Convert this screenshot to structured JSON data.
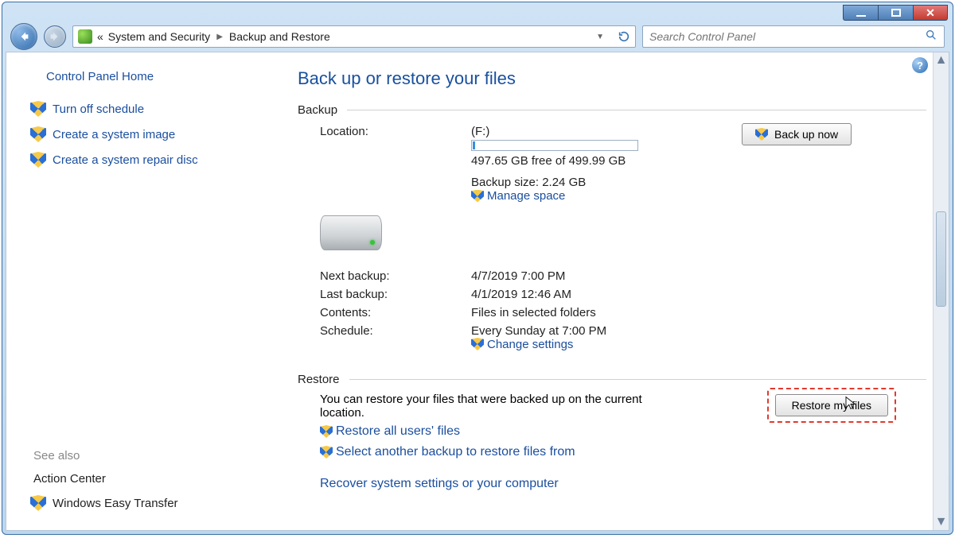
{
  "titlebar": {},
  "address": {
    "chevrons": "«",
    "crumb1": "System and Security",
    "crumb2": "Backup and Restore"
  },
  "search": {
    "placeholder": "Search Control Panel"
  },
  "sidebar": {
    "home": "Control Panel Home",
    "links": [
      "Turn off schedule",
      "Create a system image",
      "Create a system repair disc"
    ],
    "see_also_label": "See also",
    "see_also": [
      "Action Center",
      "Windows Easy Transfer"
    ]
  },
  "main": {
    "title": "Back up or restore your files",
    "backup_header": "Backup",
    "restore_header": "Restore",
    "location_label": "Location:",
    "location_value": "(F:)",
    "free_space": "497.65 GB free of 499.99 GB",
    "backup_size": "Backup size: 2.24 GB",
    "manage_space": "Manage space",
    "backup_now": "Back up now",
    "next_label": "Next backup:",
    "next_value": "4/7/2019 7:00 PM",
    "last_label": "Last backup:",
    "last_value": "4/1/2019 12:46 AM",
    "contents_label": "Contents:",
    "contents_value": "Files in selected folders",
    "schedule_label": "Schedule:",
    "schedule_value": "Every Sunday at 7:00 PM",
    "change_settings": "Change settings",
    "restore_desc": "You can restore your files that were backed up on the current location.",
    "restore_btn": "Restore my files",
    "restore_all": "Restore all users' files",
    "restore_other": "Select another backup to restore files from",
    "recover": "Recover system settings or your computer"
  }
}
